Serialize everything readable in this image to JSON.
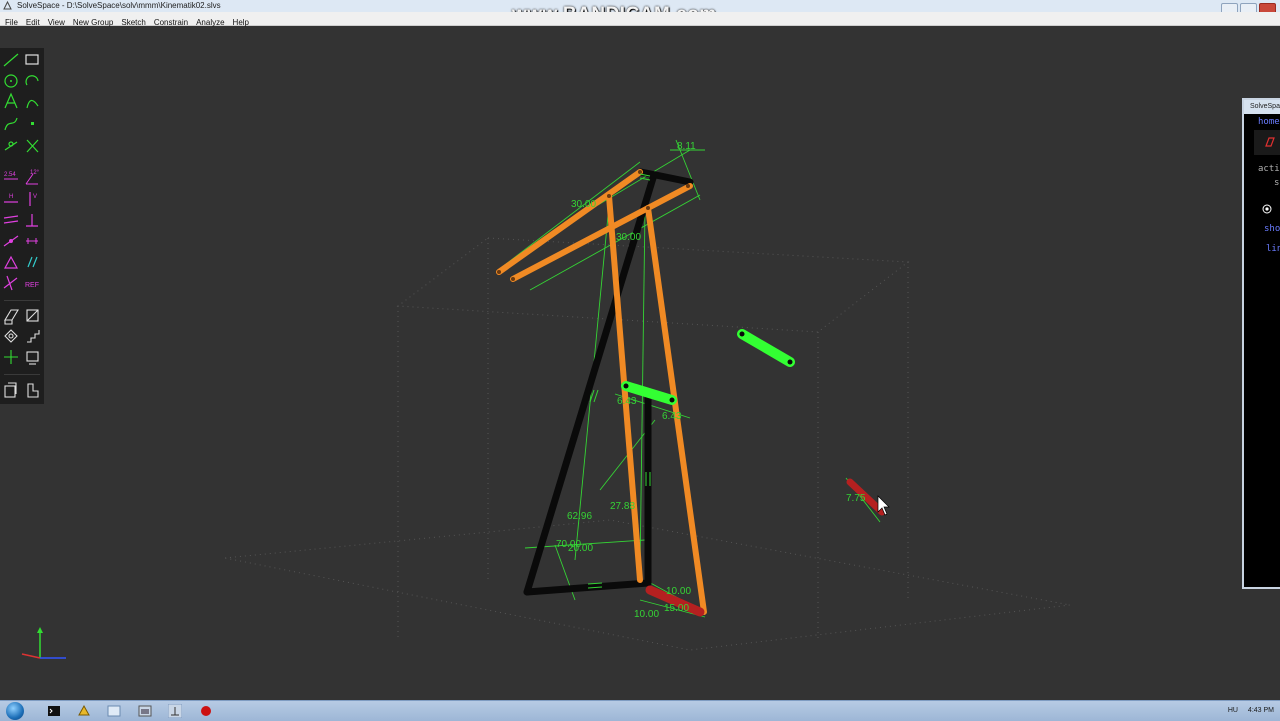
{
  "window": {
    "title": "SolveSpace - D:\\SolveSpace\\solv\\mmm\\Kinematik02.slvs"
  },
  "watermark": "www.BANDICAM.com",
  "menu": [
    "File",
    "Edit",
    "View",
    "New Group",
    "Sketch",
    "Constrain",
    "Analyze",
    "Help"
  ],
  "toolbar_icons": [
    "line-segment-icon",
    "rectangle-icon",
    "circle-icon",
    "arc-icon",
    "text-icon",
    "tangent-arc-icon",
    "cubic-spline-icon",
    "datum-point-icon",
    "workplane-icon",
    "split-curves-icon",
    "distance-constraint-icon",
    "angle-constraint-icon",
    "horizontal-constraint-icon",
    "vertical-constraint-icon",
    "parallel-constraint-icon",
    "perpendicular-constraint-icon",
    "on-point-constraint-icon",
    "symmetric-constraint-icon",
    "equal-length-constraint-icon",
    "same-orientation-icon",
    "other-supplementary-icon",
    "reference-toggle-icon",
    "extrude-icon",
    "lathe-icon",
    "step-rotating-icon",
    "step-translating-icon",
    "sketch-in-3d-icon",
    "sketch-in-workplane-icon",
    "import-assembly-icon",
    "new-workplane-icon"
  ],
  "toolbar_ref_label": "REF",
  "dimensions": {
    "d_top": "8.11",
    "d_30a": "30.00",
    "d_30b": "30.00",
    "d_mid1": "6.43",
    "d_mid2": "6.43",
    "d_6296": "62.96",
    "d_2788": "27.88",
    "d_70": "70.00",
    "d_20": "20.00",
    "d_10a": "10.00",
    "d_15": "15.00",
    "d_10b": "10.00",
    "d_775": "7.75"
  },
  "side_panel": {
    "title": "SolveSpace",
    "home": "home",
    "line_active": "acti",
    "line_s": "s",
    "line_show": "sho",
    "line_lin": "lin"
  },
  "taskbar": {
    "language": "HU",
    "time": "4:43 PM"
  },
  "colors": {
    "background": "#333333",
    "orange_links": "#f08a24",
    "black_links": "#0a0a0a",
    "green_constraints": "#35d435",
    "green_selected": "#33ff33",
    "red_part": "#b52020"
  }
}
